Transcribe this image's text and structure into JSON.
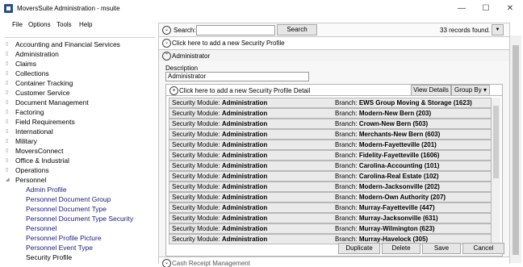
{
  "window": {
    "title": "MoversSuite Administration - msuite",
    "minimize": "—",
    "maximize": "☐",
    "close": "✕"
  },
  "menu": {
    "items": [
      "File",
      "Options",
      "Tools",
      "Help"
    ]
  },
  "tree": {
    "top_items": [
      "Accounting and Financial Services",
      "Administration",
      "Claims",
      "Collections",
      "Container Tracking",
      "Customer Service",
      "Document Management",
      "Factoring",
      "Field Requirements",
      "International",
      "Military",
      "MoversConnect",
      "Office & Industrial",
      "Operations",
      "Personnel"
    ],
    "personnel_children": [
      "Admin Profile",
      "Personnel Document Group",
      "Personnel Document Type",
      "Personnel Document Type Security",
      "Personnel",
      "Personnel Profile Picture",
      "Personnel Event Type",
      "Security Profile"
    ]
  },
  "search": {
    "label": "Search:",
    "value": "",
    "button": "Search",
    "records": "33 records found."
  },
  "add_profile": {
    "label": "Click here to add a new Security Profile"
  },
  "section": {
    "title": "Administrator"
  },
  "detail": {
    "description_label": "Description",
    "description_value": "Administrator",
    "add_detail_label": "Click here to add a new Security Profile Detail",
    "view_details": "View Details",
    "group_by": "Group By"
  },
  "grid": {
    "module_prefix": "Security Module:",
    "branch_prefix": "Branch:",
    "rows": [
      {
        "module": "Administration",
        "branch": "EWS Group Moving & Storage (1623)"
      },
      {
        "module": "Administration",
        "branch": "Modern-New Bern (203)"
      },
      {
        "module": "Administration",
        "branch": "Crown-New Bern (503)"
      },
      {
        "module": "Administration",
        "branch": "Merchants-New Bern (603)"
      },
      {
        "module": "Administration",
        "branch": "Modern-Fayetteville (201)"
      },
      {
        "module": "Administration",
        "branch": "Fidelity-Fayetteville (1606)"
      },
      {
        "module": "Administration",
        "branch": "Carolina-Accounting (101)"
      },
      {
        "module": "Administration",
        "branch": "Carolina-Real Estate (102)"
      },
      {
        "module": "Administration",
        "branch": "Modern-Jacksonville (202)"
      },
      {
        "module": "Administration",
        "branch": "Modern-Own Authority (207)"
      },
      {
        "module": "Administration",
        "branch": "Murray-Fayetteville (447)"
      },
      {
        "module": "Administration",
        "branch": "Murray-Jacksonville (631)"
      },
      {
        "module": "Administration",
        "branch": "Murray-Wilmington (623)"
      },
      {
        "module": "Administration",
        "branch": "Murray-Havelock (305)"
      }
    ]
  },
  "actions": {
    "duplicate": "Duplicate",
    "delete": "Delete",
    "save": "Save",
    "cancel": "Cancel"
  },
  "bottom_section": {
    "title": "Cash Receipt Management"
  }
}
